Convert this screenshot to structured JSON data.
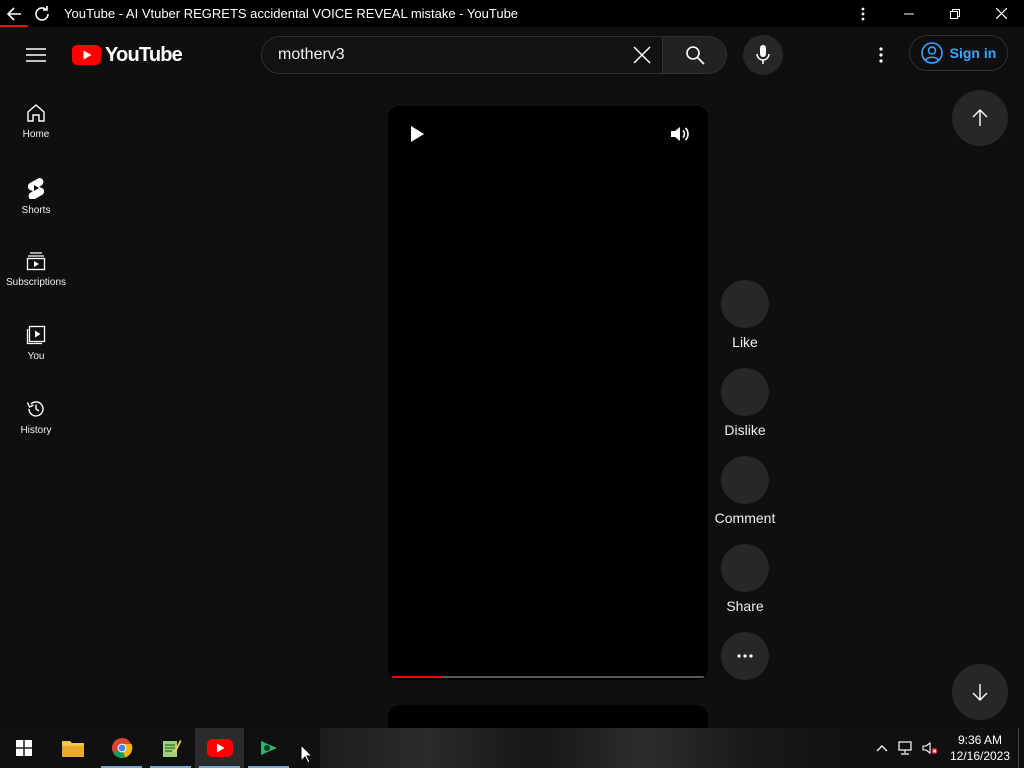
{
  "window": {
    "title": "YouTube - AI Vtuber REGRETS accidental VOICE REVEAL mistake - YouTube"
  },
  "masthead": {
    "logo_text": "YouTube",
    "search_value": "motherv3",
    "signin_label": "Sign in"
  },
  "guide": {
    "items": [
      {
        "label": "Home",
        "icon": "home-icon"
      },
      {
        "label": "Shorts",
        "icon": "shorts-icon"
      },
      {
        "label": "Subscriptions",
        "icon": "subscriptions-icon"
      },
      {
        "label": "You",
        "icon": "you-icon"
      },
      {
        "label": "History",
        "icon": "history-icon"
      }
    ]
  },
  "player": {
    "progress_fraction": 0.16
  },
  "actions": {
    "like": "Like",
    "dislike": "Dislike",
    "comment": "Comment",
    "share": "Share"
  },
  "taskbar": {
    "time": "9:36 AM",
    "date": "12/16/2023",
    "apps": [
      "windows-start-icon",
      "file-explorer-icon",
      "chrome-icon",
      "notepad-icon",
      "youtube-app-icon",
      "media-app-icon"
    ]
  },
  "colors": {
    "background": "#0f0f0f",
    "brand_red": "#ff0000",
    "link_blue": "#3ea6ff"
  }
}
